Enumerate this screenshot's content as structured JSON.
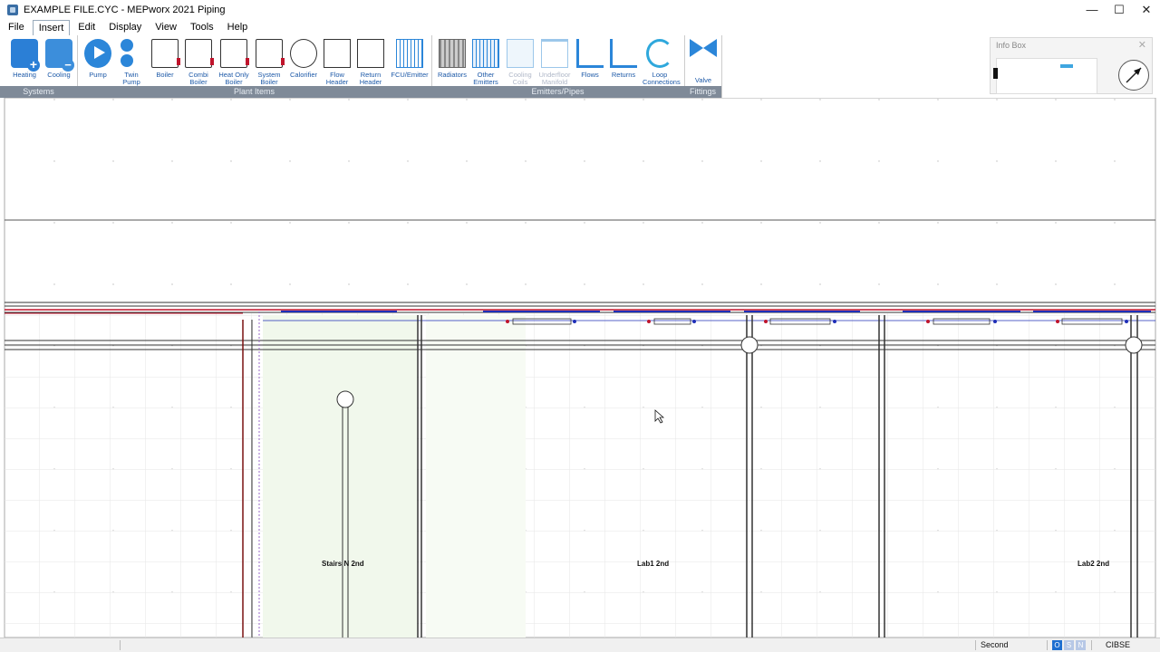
{
  "window": {
    "title": "EXAMPLE FILE.CYC - MEPworx 2021 Piping",
    "minimize": "—",
    "maximize": "☐",
    "close": "✕"
  },
  "menu": [
    "File",
    "Insert",
    "Edit",
    "Display",
    "View",
    "Tools",
    "Help"
  ],
  "ribbon": {
    "groups": {
      "systems": "Systems",
      "plant": "Plant Items",
      "emitters": "Emitters/Pipes",
      "fittings": "Fittings"
    },
    "buttons": {
      "heating": "Heating",
      "cooling": "Cooling",
      "pump": "Pump",
      "twin_pump": "Twin Pump",
      "boiler": "Boiler",
      "combi_boiler": "Combi Boiler",
      "heat_only_boiler": "Heat Only Boiler",
      "system_boiler": "System Boiler",
      "calorifier": "Calorifier",
      "flow_header": "Flow Header",
      "return_header": "Return Header",
      "fcu_emitter": "FCU/Emitter",
      "radiators": "Radiators",
      "other_emitters": "Other Emitters",
      "cooling_coils": "Cooling Coils",
      "underfloor_manifold": "Underfloor Manifold",
      "flows": "Flows",
      "returns": "Returns",
      "loop_connections": "Loop Connections",
      "valve": "Valve"
    }
  },
  "info_box": {
    "title": "Info Box",
    "close": "✕"
  },
  "rooms": [
    "Stairs N 2nd",
    "Lab1 2nd",
    "Lab2 2nd"
  ],
  "status": {
    "floor": "Second",
    "modes": [
      "O",
      "S",
      "N"
    ],
    "standard": "CIBSE"
  },
  "colors": {
    "ribbon_group_bg": "#7f8a98",
    "flow_pipe": "#c0142c",
    "return_pipe": "#1f2fb8",
    "ribbon_label": "#1e5aa8"
  }
}
